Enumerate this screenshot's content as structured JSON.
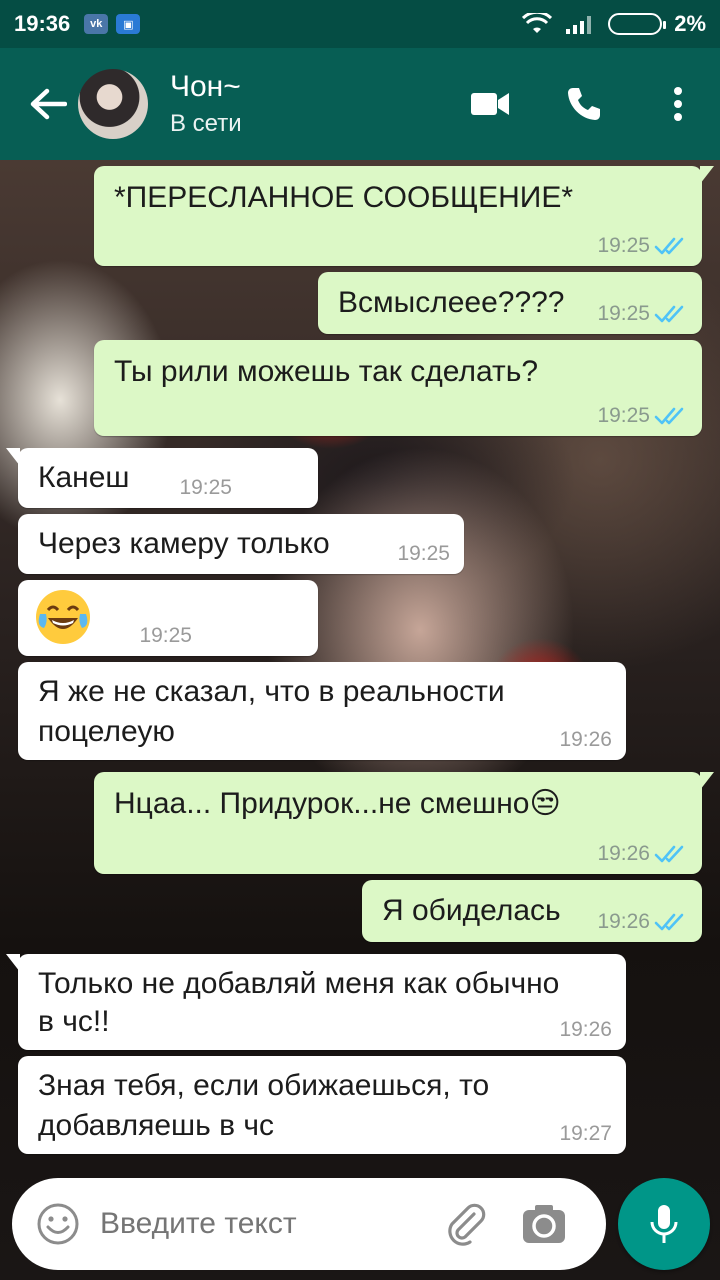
{
  "status_bar": {
    "time": "19:36",
    "app1": "vk",
    "app2": "▣",
    "battery": "2%"
  },
  "header": {
    "contact_name": "Чон~",
    "contact_status": "В сети"
  },
  "messages": [
    {
      "text": "*ПЕРЕСЛАННОЕ СООБЩЕНИЕ*",
      "time": "19:25",
      "direction": "out",
      "read": true
    },
    {
      "text": "Всмыслеее????",
      "time": "19:25",
      "direction": "out",
      "read": true
    },
    {
      "text": "Ты рили можешь так сделать?",
      "time": "19:25",
      "direction": "out",
      "read": true
    },
    {
      "text": "Канеш",
      "time": "19:25",
      "direction": "in"
    },
    {
      "text": "Через камеру только",
      "time": "19:25",
      "direction": "in"
    },
    {
      "text": "😂",
      "time": "19:25",
      "direction": "in"
    },
    {
      "text_line1": "Я же не сказал, что в реальности",
      "text_line2": "поцелеую",
      "time": "19:26",
      "direction": "in"
    },
    {
      "text": "Нцаа... Придурок...не смешно😒",
      "time": "19:26",
      "direction": "out",
      "read": true
    },
    {
      "text": "Я обиделась",
      "time": "19:26",
      "direction": "out",
      "read": true
    },
    {
      "text_line1": "Только не добавляй меня как обычно",
      "text_line2": "в чс!!",
      "time": "19:26",
      "direction": "in"
    },
    {
      "text_line1": "Зная тебя, если обижаешься, то",
      "text_line2": "добавляешь в чс",
      "time": "19:27",
      "direction": "in"
    }
  ],
  "input": {
    "placeholder": "Введите текст"
  },
  "colors": {
    "header": "#075e54",
    "statusbar": "#054d44",
    "outgoing": "#dcf8c6",
    "incoming": "#ffffff",
    "mic": "#009688",
    "read_ticks": "#4fc3f7"
  },
  "icons": [
    "back-arrow-icon",
    "video-call-icon",
    "phone-icon",
    "more-vert-icon",
    "emoji-icon",
    "attach-icon",
    "camera-icon",
    "mic-icon",
    "double-check-icon"
  ]
}
